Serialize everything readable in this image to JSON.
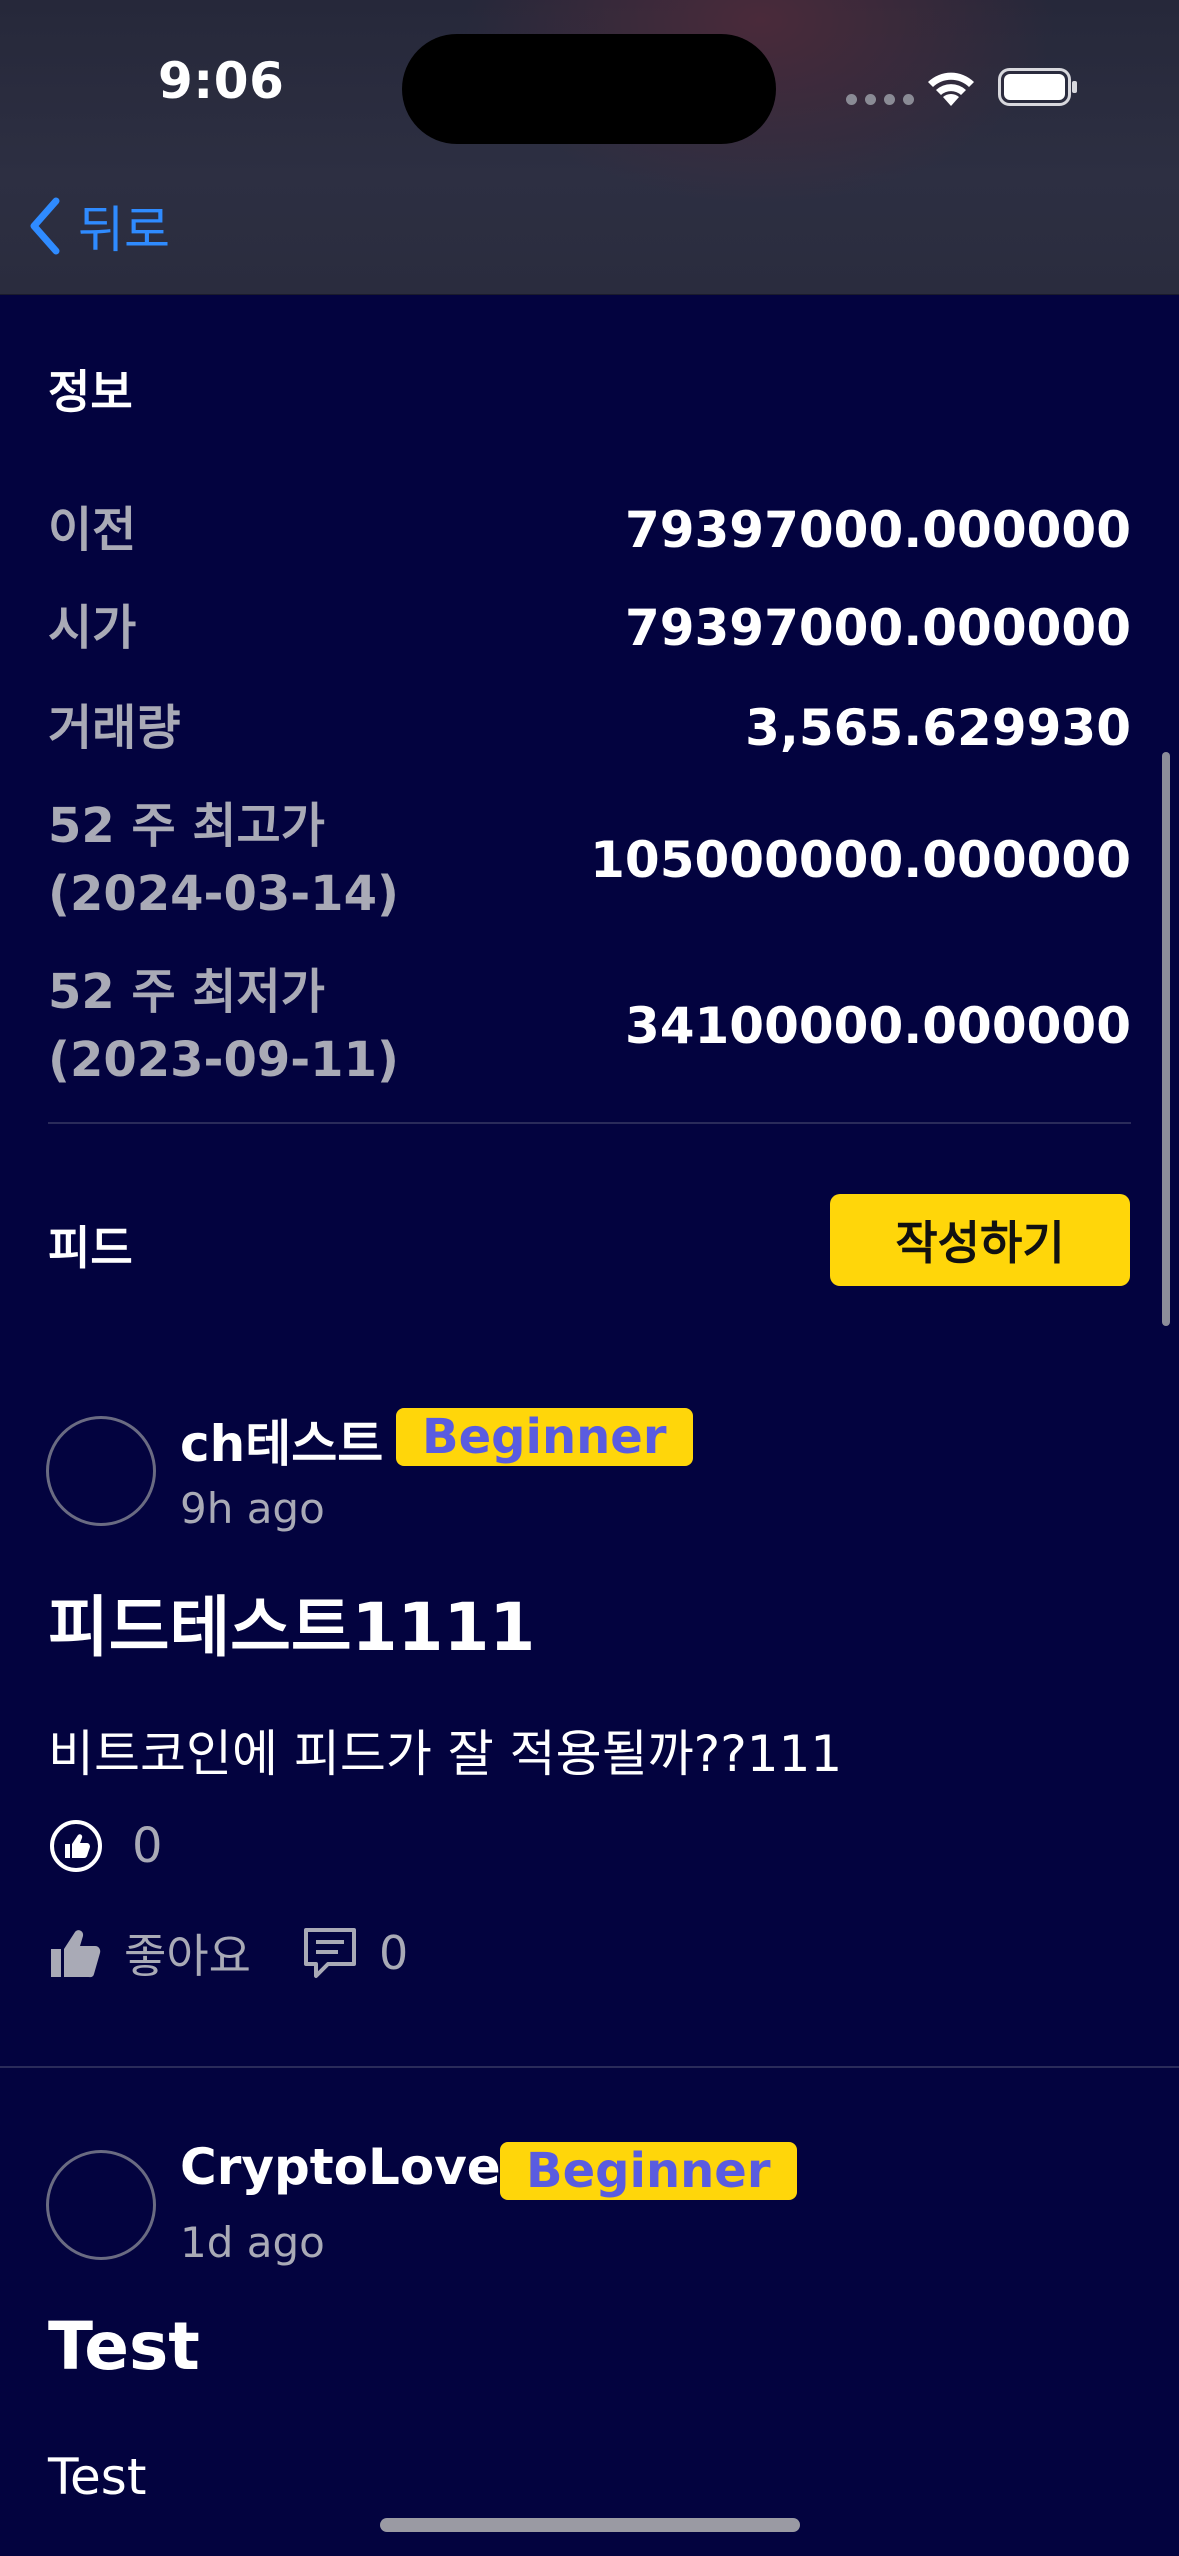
{
  "status_bar": {
    "time": "9:06"
  },
  "nav": {
    "back_label": "뒤로"
  },
  "info": {
    "title": "정보",
    "rows": [
      {
        "label": "이전",
        "value": "79397000.000000"
      },
      {
        "label": "시가",
        "value": "79397000.000000"
      },
      {
        "label": "거래량",
        "value": "3,565.629930"
      },
      {
        "label_line1": "52 주 최고가",
        "label_line2": "(2024-03-14)",
        "value": "105000000.000000"
      },
      {
        "label_line1": "52 주 최저가",
        "label_line2": "(2023-09-11)",
        "value": "34100000.000000"
      }
    ]
  },
  "feed": {
    "title": "피드",
    "write_button": "작성하기",
    "posts": [
      {
        "author": "ch테스트",
        "badge": "Beginner",
        "time_ago": "9h ago",
        "title": "피드테스트1111",
        "body": "비트코인에 피드가 잘 적용될까??111",
        "like_count": "0",
        "like_label": "좋아요",
        "comment_count": "0"
      },
      {
        "author": "CryptoLover",
        "badge": "Beginner",
        "time_ago": "1d ago",
        "title": "Test",
        "body": "Test"
      }
    ]
  },
  "colors": {
    "background": "#03033f",
    "accent": "#ffd60a",
    "badge_text": "#5a5ce0",
    "link": "#2f8bff",
    "muted": "#a9aab6"
  }
}
